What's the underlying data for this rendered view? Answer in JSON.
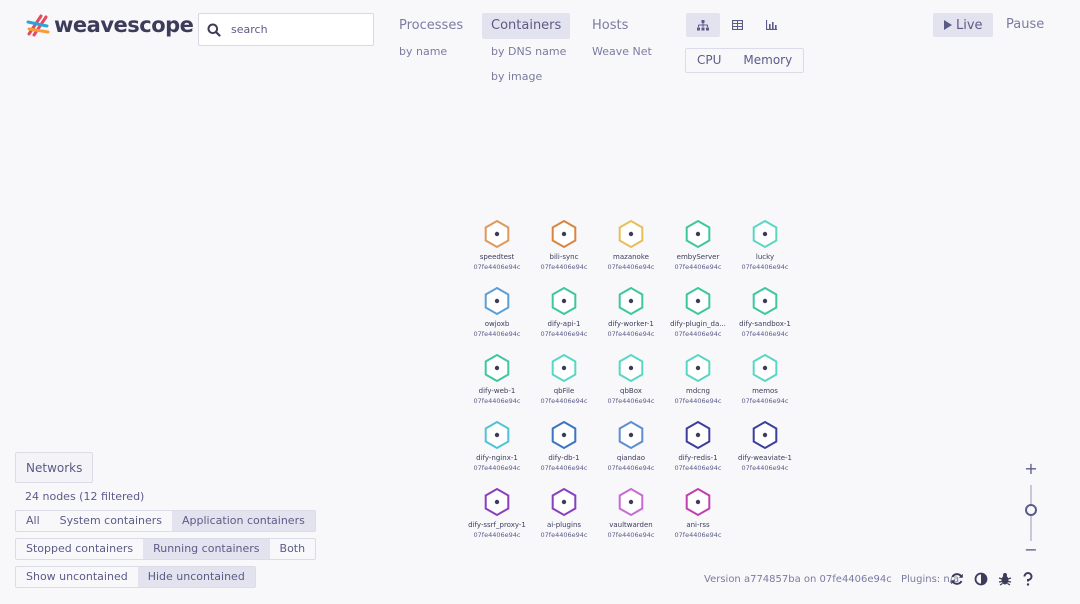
{
  "app": {
    "name": "weavescope"
  },
  "search": {
    "placeholder": "search"
  },
  "topologies": [
    {
      "label": "Processes",
      "subs": [
        "by name"
      ],
      "active": false
    },
    {
      "label": "Containers",
      "subs": [
        "by DNS name",
        "by image"
      ],
      "active": true
    },
    {
      "label": "Hosts",
      "subs": [
        "Weave Net"
      ],
      "active": false
    }
  ],
  "view_modes": [
    {
      "icon": "graph-view-icon",
      "active": true
    },
    {
      "icon": "table-view-icon",
      "active": false
    },
    {
      "icon": "resources-view-icon",
      "active": false
    }
  ],
  "metrics": [
    "CPU",
    "Memory"
  ],
  "controls": {
    "live": "Live",
    "pause": "Pause"
  },
  "nodes": [
    {
      "label": "speedtest",
      "sub": "07fe4406e94c",
      "color": "#e0975c"
    },
    {
      "label": "bili-sync",
      "sub": "07fe4406e94c",
      "color": "#d7863f"
    },
    {
      "label": "mazanoke",
      "sub": "07fe4406e94c",
      "color": "#e6bf5a"
    },
    {
      "label": "embyServer",
      "sub": "07fe4406e94c",
      "color": "#3ec79d"
    },
    {
      "label": "lucky",
      "sub": "07fe4406e94c",
      "color": "#5ad7c2"
    },
    {
      "label": "owjoxb",
      "sub": "07fe4406e94c",
      "color": "#5c9fd6"
    },
    {
      "label": "dify-api-1",
      "sub": "07fe4406e94c",
      "color": "#3ec79d"
    },
    {
      "label": "dify-worker-1",
      "sub": "07fe4406e94c",
      "color": "#3ec79d"
    },
    {
      "label": "dify-plugin_da...",
      "sub": "07fe4406e94c",
      "color": "#3ec79d"
    },
    {
      "label": "dify-sandbox-1",
      "sub": "07fe4406e94c",
      "color": "#3ec79d"
    },
    {
      "label": "dify-web-1",
      "sub": "07fe4406e94c",
      "color": "#3ec79d"
    },
    {
      "label": "qbFile",
      "sub": "07fe4406e94c",
      "color": "#5ad7c2"
    },
    {
      "label": "qbBox",
      "sub": "07fe4406e94c",
      "color": "#5ad7c2"
    },
    {
      "label": "mdcng",
      "sub": "07fe4406e94c",
      "color": "#5ad7c2"
    },
    {
      "label": "memos",
      "sub": "07fe4406e94c",
      "color": "#5ad7c2"
    },
    {
      "label": "dify-nginx-1",
      "sub": "07fe4406e94c",
      "color": "#4fc3d8"
    },
    {
      "label": "dify-db-1",
      "sub": "07fe4406e94c",
      "color": "#3b74c4"
    },
    {
      "label": "qiandao",
      "sub": "07fe4406e94c",
      "color": "#5c8ed0"
    },
    {
      "label": "dify-redis-1",
      "sub": "07fe4406e94c",
      "color": "#3c3f9c"
    },
    {
      "label": "dify-weaviate-1",
      "sub": "07fe4406e94c",
      "color": "#3c3f9c"
    },
    {
      "label": "dify-ssrf_proxy-1",
      "sub": "07fe4406e94c",
      "color": "#8a3fbf"
    },
    {
      "label": "ai-plugins",
      "sub": "07fe4406e94c",
      "color": "#8a3fbf"
    },
    {
      "label": "vaultwarden",
      "sub": "07fe4406e94c",
      "color": "#c86ad6"
    },
    {
      "label": "ani-rss",
      "sub": "07fe4406e94c",
      "color": "#c23fae"
    }
  ],
  "networks": {
    "label": "Networks"
  },
  "status": {
    "node_count": "24 nodes (12 filtered)"
  },
  "filters": [
    {
      "options": [
        "All",
        "System containers",
        "Application containers"
      ],
      "active": 2
    },
    {
      "options": [
        "Stopped containers",
        "Running containers",
        "Both"
      ],
      "active": 1
    },
    {
      "options": [
        "Show uncontained",
        "Hide uncontained"
      ],
      "active": 1
    }
  ],
  "zoom": {
    "in": "+",
    "out": "−",
    "level": 0.55
  },
  "footer": {
    "version": "Version a774857ba on 07fe4406e94c",
    "plugins": "Plugins: n/a"
  },
  "footer_icons": [
    "refresh-icon",
    "contrast-icon",
    "bug-icon",
    "help-icon"
  ]
}
